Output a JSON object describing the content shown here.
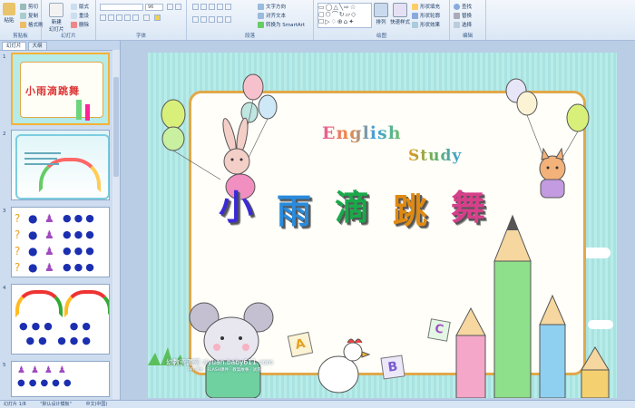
{
  "ribbon": {
    "clipboard": {
      "label": "剪贴板",
      "paste": "粘贴",
      "cut": "剪切",
      "copy": "复制",
      "format": "格式刷"
    },
    "slides": {
      "label": "幻灯片",
      "new_slide": "新建\n幻灯片",
      "layout": "版式",
      "reset": "重设",
      "delete": "删除"
    },
    "font": {
      "label": "字体",
      "font_size": "96"
    },
    "paragraph": {
      "label": "段落",
      "text_direction": "文字方向",
      "align_text": "对齐文本",
      "smartart": "转换为 SmartArt"
    },
    "drawing": {
      "label": "绘图",
      "arrange": "排列",
      "quick_styles": "快速样式",
      "shape_fill": "形状填充",
      "shape_outline": "形状轮廓",
      "shape_effects": "形状效果"
    },
    "editing": {
      "label": "编辑",
      "find": "查找",
      "replace": "替换",
      "select": "选择"
    }
  },
  "pane": {
    "tab_slides": "幻灯片",
    "tab_outline": "大纲",
    "thumbnails": [
      {
        "num": "1",
        "title": "小雨滴跳舞"
      },
      {
        "num": "2"
      },
      {
        "num": "3"
      },
      {
        "num": "4"
      },
      {
        "num": "5"
      }
    ]
  },
  "slide": {
    "english": "English",
    "study": "Study",
    "title_chars": [
      "小",
      "雨",
      "滴",
      "跳",
      "舞"
    ],
    "blocks": [
      "A",
      "B",
      "C"
    ],
    "watermark": "幼教资源网 ziyuan.baby611.com",
    "watermark_sub": "PPT课件 · FLASH课件 · 教案故事 · 试卷"
  },
  "status": {
    "slide_pos": "幻灯片 1/8",
    "theme": "\"默认设计模板\"",
    "language": "中文(中国)"
  },
  "colors": {
    "title": [
      "#3b2bd6",
      "#2a8bdc",
      "#1aa84a",
      "#e08a12",
      "#d63f8a"
    ],
    "accent": "#f5b234"
  }
}
